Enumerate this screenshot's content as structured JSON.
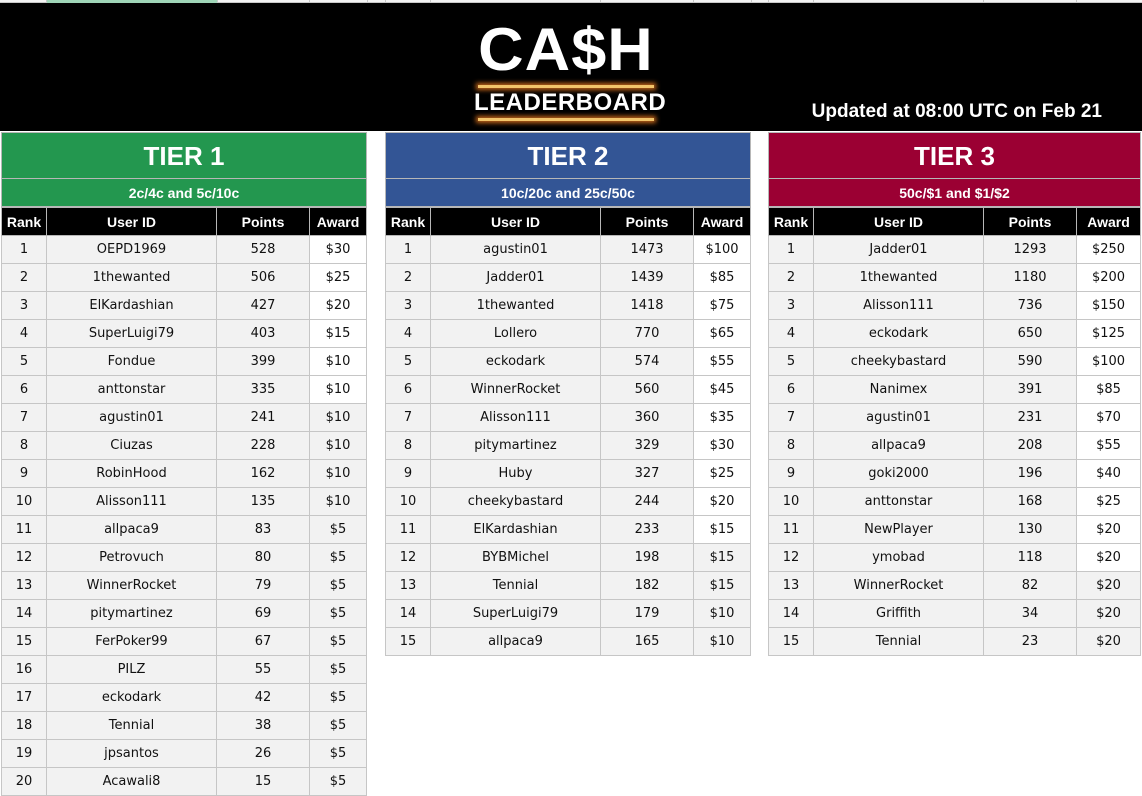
{
  "banner": {
    "logo_top": "CA$H",
    "logo_bottom": "LEADERBOARD",
    "updated_text": "Updated at 08:00 UTC on Feb 21",
    "background": "#000000"
  },
  "columns": {
    "rank": "Rank",
    "user_id": "User ID",
    "points": "Points",
    "award": "Award"
  },
  "tiers": [
    {
      "title": "TIER 1",
      "stakes": "2c/4c and 5c/10c",
      "color": "#23974f",
      "rows": [
        {
          "rank": "1",
          "user": "OEPD1969",
          "points": "528",
          "award": "$30",
          "award_highlight": true
        },
        {
          "rank": "2",
          "user": "1thewanted",
          "points": "506",
          "award": "$25",
          "award_highlight": true
        },
        {
          "rank": "3",
          "user": "ElKardashian",
          "points": "427",
          "award": "$20",
          "award_highlight": true
        },
        {
          "rank": "4",
          "user": "SuperLuigi79",
          "points": "403",
          "award": "$15",
          "award_highlight": true
        },
        {
          "rank": "5",
          "user": "Fondue",
          "points": "399",
          "award": "$10",
          "award_highlight": true
        },
        {
          "rank": "6",
          "user": "anttonstar",
          "points": "335",
          "award": "$10",
          "award_highlight": true
        },
        {
          "rank": "7",
          "user": "agustin01",
          "points": "241",
          "award": "$10",
          "award_highlight": false
        },
        {
          "rank": "8",
          "user": "Ciuzas",
          "points": "228",
          "award": "$10",
          "award_highlight": false
        },
        {
          "rank": "9",
          "user": "RobinHood",
          "points": "162",
          "award": "$10",
          "award_highlight": false
        },
        {
          "rank": "10",
          "user": "Alisson111",
          "points": "135",
          "award": "$10",
          "award_highlight": false
        },
        {
          "rank": "11",
          "user": "allpaca9",
          "points": "83",
          "award": "$5",
          "award_highlight": false
        },
        {
          "rank": "12",
          "user": "Petrovuch",
          "points": "80",
          "award": "$5",
          "award_highlight": false
        },
        {
          "rank": "13",
          "user": "WinnerRocket",
          "points": "79",
          "award": "$5",
          "award_highlight": false
        },
        {
          "rank": "14",
          "user": "pitymartinez",
          "points": "69",
          "award": "$5",
          "award_highlight": false
        },
        {
          "rank": "15",
          "user": "FerPoker99",
          "points": "67",
          "award": "$5",
          "award_highlight": false
        },
        {
          "rank": "16",
          "user": "PILZ",
          "points": "55",
          "award": "$5",
          "award_highlight": false
        },
        {
          "rank": "17",
          "user": "eckodark",
          "points": "42",
          "award": "$5",
          "award_highlight": false
        },
        {
          "rank": "18",
          "user": "Tennial",
          "points": "38",
          "award": "$5",
          "award_highlight": false
        },
        {
          "rank": "19",
          "user": "jpsantos",
          "points": "26",
          "award": "$5",
          "award_highlight": false
        },
        {
          "rank": "20",
          "user": "Acawali8",
          "points": "15",
          "award": "$5",
          "award_highlight": false
        }
      ]
    },
    {
      "title": "TIER 2",
      "stakes": "10c/20c and 25c/50c",
      "color": "#335595",
      "rows": [
        {
          "rank": "1",
          "user": "agustin01",
          "points": "1473",
          "award": "$100",
          "award_highlight": true
        },
        {
          "rank": "2",
          "user": "Jadder01",
          "points": "1439",
          "award": "$85",
          "award_highlight": true
        },
        {
          "rank": "3",
          "user": "1thewanted",
          "points": "1418",
          "award": "$75",
          "award_highlight": true
        },
        {
          "rank": "4",
          "user": "Lollero",
          "points": "770",
          "award": "$65",
          "award_highlight": true
        },
        {
          "rank": "5",
          "user": "eckodark",
          "points": "574",
          "award": "$55",
          "award_highlight": true
        },
        {
          "rank": "6",
          "user": "WinnerRocket",
          "points": "560",
          "award": "$45",
          "award_highlight": true
        },
        {
          "rank": "7",
          "user": "Alisson111",
          "points": "360",
          "award": "$35",
          "award_highlight": true
        },
        {
          "rank": "8",
          "user": "pitymartinez",
          "points": "329",
          "award": "$30",
          "award_highlight": true
        },
        {
          "rank": "9",
          "user": "Huby",
          "points": "327",
          "award": "$25",
          "award_highlight": true
        },
        {
          "rank": "10",
          "user": "cheekybastard",
          "points": "244",
          "award": "$20",
          "award_highlight": true
        },
        {
          "rank": "11",
          "user": "ElKardashian",
          "points": "233",
          "award": "$15",
          "award_highlight": true
        },
        {
          "rank": "12",
          "user": "BYBMichel",
          "points": "198",
          "award": "$15",
          "award_highlight": false
        },
        {
          "rank": "13",
          "user": "Tennial",
          "points": "182",
          "award": "$15",
          "award_highlight": false
        },
        {
          "rank": "14",
          "user": "SuperLuigi79",
          "points": "179",
          "award": "$10",
          "award_highlight": false
        },
        {
          "rank": "15",
          "user": "allpaca9",
          "points": "165",
          "award": "$10",
          "award_highlight": false
        }
      ]
    },
    {
      "title": "TIER 3",
      "stakes": "50c/$1 and $1/$2",
      "color": "#9b0033",
      "rows": [
        {
          "rank": "1",
          "user": "Jadder01",
          "points": "1293",
          "award": "$250",
          "award_highlight": true
        },
        {
          "rank": "2",
          "user": "1thewanted",
          "points": "1180",
          "award": "$200",
          "award_highlight": true
        },
        {
          "rank": "3",
          "user": "Alisson111",
          "points": "736",
          "award": "$150",
          "award_highlight": true
        },
        {
          "rank": "4",
          "user": "eckodark",
          "points": "650",
          "award": "$125",
          "award_highlight": true
        },
        {
          "rank": "5",
          "user": "cheekybastard",
          "points": "590",
          "award": "$100",
          "award_highlight": true
        },
        {
          "rank": "6",
          "user": "Nanimex",
          "points": "391",
          "award": "$85",
          "award_highlight": true
        },
        {
          "rank": "7",
          "user": "agustin01",
          "points": "231",
          "award": "$70",
          "award_highlight": true
        },
        {
          "rank": "8",
          "user": "allpaca9",
          "points": "208",
          "award": "$55",
          "award_highlight": true
        },
        {
          "rank": "9",
          "user": "goki2000",
          "points": "196",
          "award": "$40",
          "award_highlight": true
        },
        {
          "rank": "10",
          "user": "anttonstar",
          "points": "168",
          "award": "$25",
          "award_highlight": true
        },
        {
          "rank": "11",
          "user": "NewPlayer",
          "points": "130",
          "award": "$20",
          "award_highlight": true
        },
        {
          "rank": "12",
          "user": "ymobad",
          "points": "118",
          "award": "$20",
          "award_highlight": true
        },
        {
          "rank": "13",
          "user": "WinnerRocket",
          "points": "82",
          "award": "$20",
          "award_highlight": false
        },
        {
          "rank": "14",
          "user": "Griffith",
          "points": "34",
          "award": "$20",
          "award_highlight": false
        },
        {
          "rank": "15",
          "user": "Tennial",
          "points": "23",
          "award": "$20",
          "award_highlight": false
        }
      ]
    }
  ]
}
